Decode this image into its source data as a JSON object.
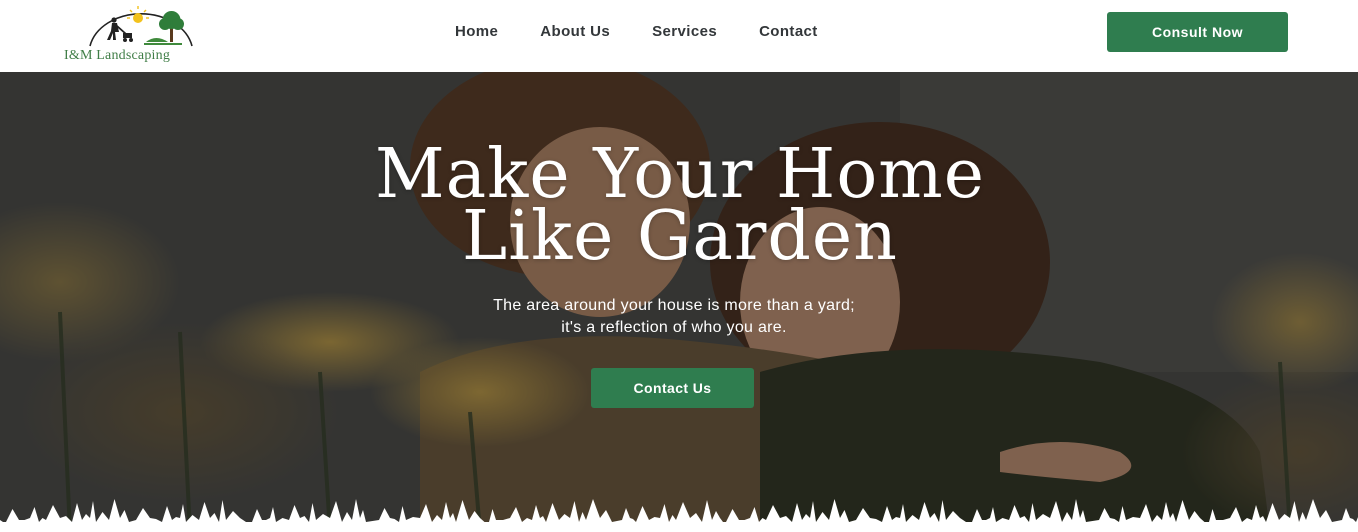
{
  "colors": {
    "brand_green": "#2f7d4f",
    "logo_green": "#3f7d46",
    "nav_text": "#33373a",
    "hero_text": "#ffffff"
  },
  "header": {
    "logo": {
      "text": "I&M Landscaping",
      "icon": "landscaping-logo-icon"
    },
    "nav": [
      {
        "label": "Home"
      },
      {
        "label": "About Us"
      },
      {
        "label": "Services"
      },
      {
        "label": "Contact"
      }
    ],
    "cta_label": "Consult Now"
  },
  "hero": {
    "title_line1": "Make Your Home",
    "title_line2": "Like Garden",
    "subtitle_line1": "The area around your house is more than a yard;",
    "subtitle_line2": "it's a reflection of who you are.",
    "button_label": "Contact Us"
  }
}
